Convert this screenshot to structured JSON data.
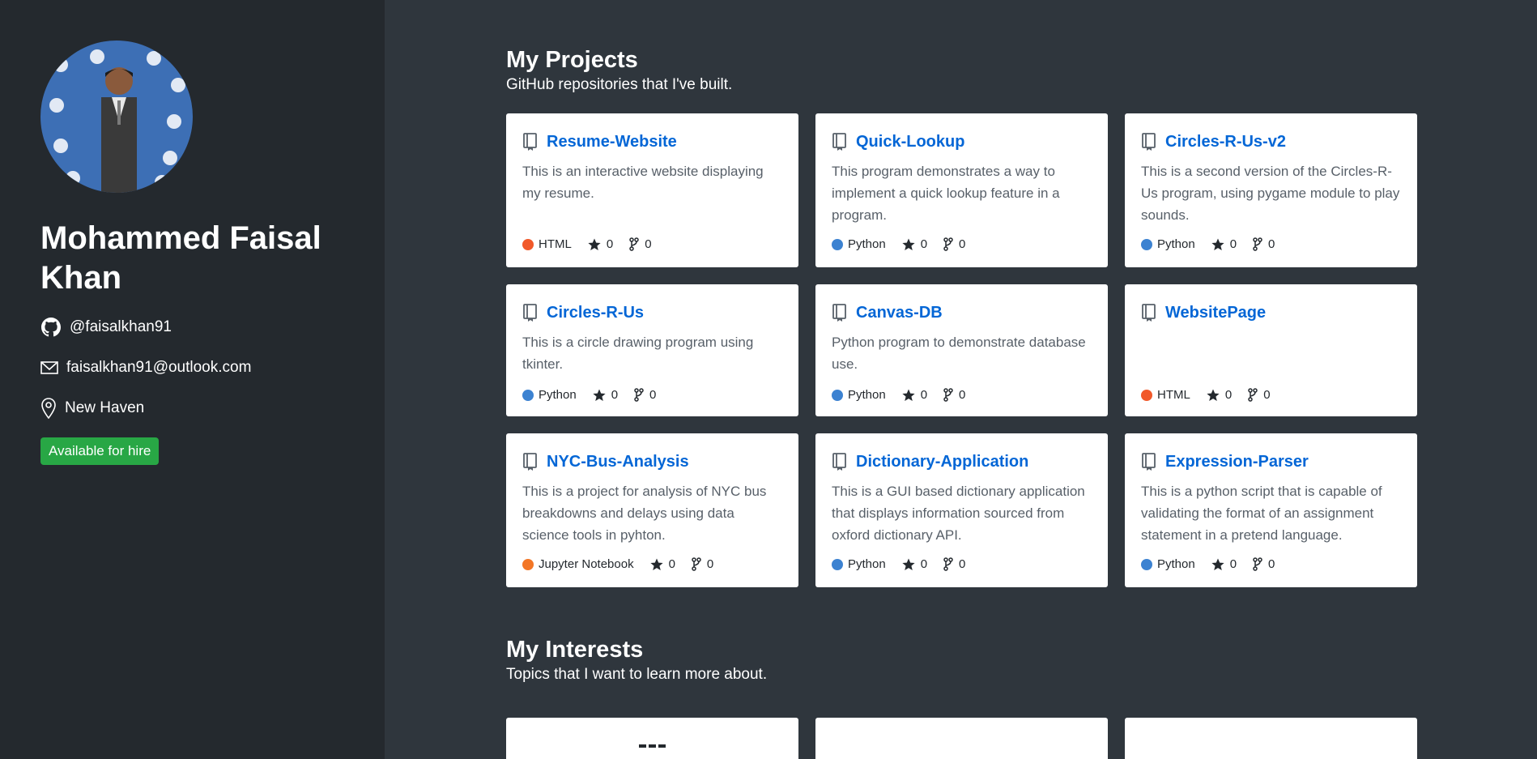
{
  "profile": {
    "name": "Mohammed Faisal Khan",
    "github": "@faisalkhan91",
    "email": "faisalkhan91@outlook.com",
    "location": "New Haven",
    "hire_badge": "Available for hire"
  },
  "projects": {
    "title": "My Projects",
    "subtitle": "GitHub repositories that I've built.",
    "items": [
      {
        "name": "Resume-Website",
        "desc": "This is an interactive website displaying my resume.",
        "lang": "HTML",
        "lang_color": "#f1592a",
        "stars": "0",
        "forks": "0"
      },
      {
        "name": "Quick-Lookup",
        "desc": "This program demonstrates a way to implement a quick lookup feature in a program.",
        "lang": "Python",
        "lang_color": "#3c82d1",
        "stars": "0",
        "forks": "0"
      },
      {
        "name": "Circles-R-Us-v2",
        "desc": "This is a second version of the Circles-R-Us program, using pygame module to play sounds.",
        "lang": "Python",
        "lang_color": "#3c82d1",
        "stars": "0",
        "forks": "0"
      },
      {
        "name": "Circles-R-Us",
        "desc": "This is a circle drawing program using tkinter.",
        "lang": "Python",
        "lang_color": "#3c82d1",
        "stars": "0",
        "forks": "0"
      },
      {
        "name": "Canvas-DB",
        "desc": "Python program to demonstrate database use.",
        "lang": "Python",
        "lang_color": "#3c82d1",
        "stars": "0",
        "forks": "0"
      },
      {
        "name": "WebsitePage",
        "desc": "",
        "lang": "HTML",
        "lang_color": "#f1592a",
        "stars": "0",
        "forks": "0"
      },
      {
        "name": "NYC-Bus-Analysis",
        "desc": "This is a project for analysis of NYC bus breakdowns and delays using data science tools in pyhton.",
        "lang": "Jupyter Notebook",
        "lang_color": "#f37626",
        "stars": "0",
        "forks": "0"
      },
      {
        "name": "Dictionary-Application",
        "desc": "This is a GUI based dictionary application that displays information sourced from oxford dictionary API.",
        "lang": "Python",
        "lang_color": "#3c82d1",
        "stars": "0",
        "forks": "0"
      },
      {
        "name": "Expression-Parser",
        "desc": "This is a python script that is capable of validating the format of an assignment statement in a pretend language.",
        "lang": "Python",
        "lang_color": "#3c82d1",
        "stars": "0",
        "forks": "0"
      }
    ]
  },
  "interests": {
    "title": "My Interests",
    "subtitle": "Topics that I want to learn more about."
  },
  "colors": {
    "sidebar_bg": "#24292e",
    "main_bg": "#2f363d",
    "link": "#0366d6",
    "hire_green": "#28a745"
  }
}
